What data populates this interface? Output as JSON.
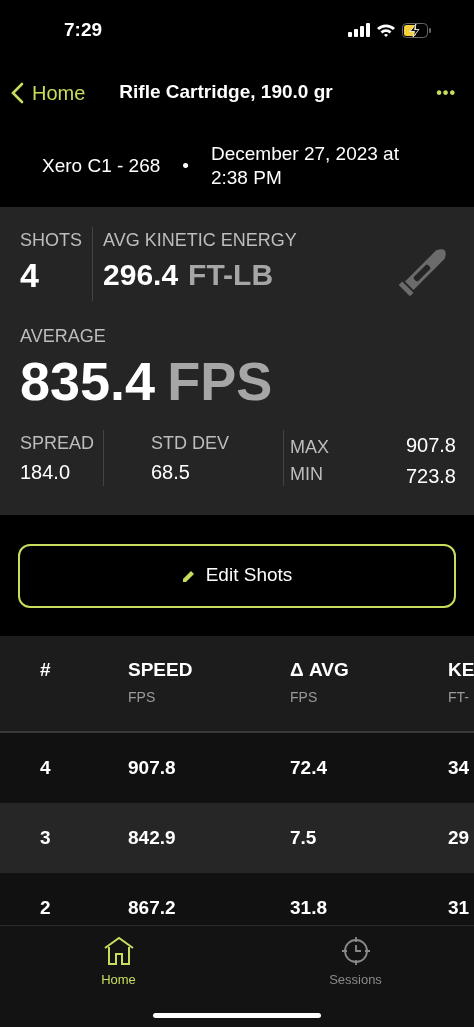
{
  "status_bar": {
    "time": "7:29"
  },
  "nav": {
    "back": "Home",
    "title": "Rifle Cartridge, 190.0 gr",
    "more": "•••"
  },
  "session": {
    "device": "Xero C1 - 268",
    "separator": "•",
    "date": "December 27, 2023 at 2:38 PM"
  },
  "stats": {
    "shots_label": "SHOTS",
    "shots": "4",
    "ke_label": "AVG KINETIC ENERGY",
    "ke_value": "296.4",
    "ke_unit": "FT-LB",
    "average_label": "AVERAGE",
    "average_value": "835.4",
    "average_unit": "FPS",
    "spread_label": "SPREAD",
    "spread": "184.0",
    "std_label": "STD DEV",
    "std": "68.5",
    "max_label": "MAX",
    "max": "907.8",
    "min_label": "MIN",
    "min": "723.8"
  },
  "edit_button": "Edit Shots",
  "table": {
    "columns": [
      {
        "title": "#"
      },
      {
        "title": "SPEED",
        "unit": "FPS"
      },
      {
        "title": "Δ AVG",
        "unit": "FPS"
      },
      {
        "title": "KE",
        "unit": "FT-"
      }
    ],
    "rows": [
      [
        "4",
        "907.8",
        "72.4",
        "34"
      ],
      [
        "3",
        "842.9",
        "7.5",
        "29"
      ],
      [
        "2",
        "867.2",
        "31.8",
        "31"
      ]
    ]
  },
  "tab_bar": [
    {
      "label": "Home",
      "kind": "home",
      "selected": true
    },
    {
      "label": "Sessions",
      "kind": "target",
      "selected": false
    }
  ]
}
